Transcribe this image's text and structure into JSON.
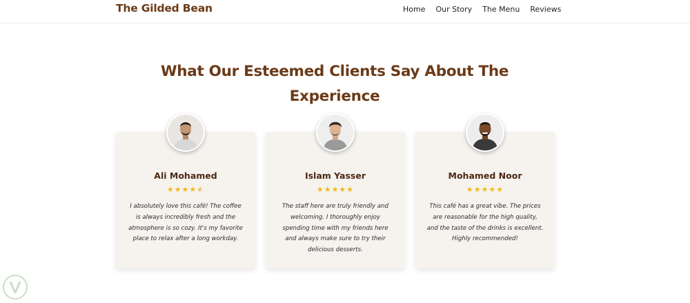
{
  "header": {
    "brand": "The Gilded Bean",
    "nav": [
      {
        "label": "Home"
      },
      {
        "label": "Our Story"
      },
      {
        "label": "The Menu"
      },
      {
        "label": "Reviews"
      }
    ]
  },
  "section": {
    "title": "What Our Esteemed Clients Say About The Experience"
  },
  "testimonials": [
    {
      "name": "Ali Mohamed",
      "rating": 4.5,
      "stars": "★★★★",
      "quote": "I absolutely love this café! The coffee is always incredibly fresh and the atmosphere is so cozy. It's my favorite place to relax after a long workday."
    },
    {
      "name": "Islam Yasser",
      "rating": 5,
      "stars": "★★★★★",
      "quote": "The staff here are truly friendly and welcoming. I thoroughly enjoy spending time with my friends here and always make sure to try their delicious desserts."
    },
    {
      "name": "Mohamed Noor",
      "rating": 5,
      "stars": "★★★★★",
      "quote": "This café has a great vibe. The prices are reasonable for the high quality, and the taste of the drinks is excellent. Highly recommended!"
    }
  ],
  "colors": {
    "brand": "#6b3a17",
    "star": "#f1b81d",
    "card_bg": "#f6f3ef"
  },
  "icons": [
    "avatar-photo",
    "star-icon",
    "verified-badge-icon"
  ]
}
